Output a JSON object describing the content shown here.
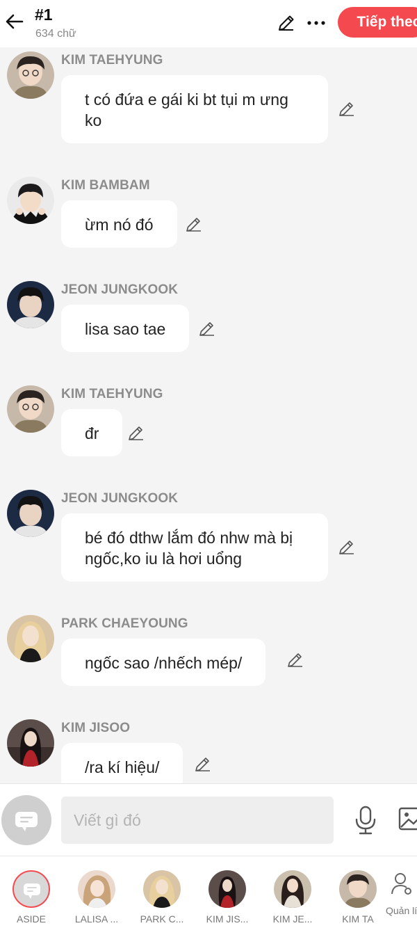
{
  "header": {
    "title": "#1",
    "word_count": "634 chữ",
    "next_label": "Tiếp theo",
    "accent_color": "#f44a4f"
  },
  "messages": [
    {
      "name": "KIM TAEHYUNG",
      "text": "t có đứa e gái ki bt tụi m ưng ko",
      "avatar": "kim-taehyung"
    },
    {
      "name": "KIM BAMBAM",
      "text": "ừm nó đó",
      "avatar": "kim-bambam"
    },
    {
      "name": "JEON JUNGKOOK",
      "text": "lisa sao tae",
      "avatar": "jeon-jungkook"
    },
    {
      "name": "KIM TAEHYUNG",
      "text": "đr",
      "avatar": "kim-taehyung"
    },
    {
      "name": "JEON JUNGKOOK",
      "text": "bé đó dthw lắm đó nhw mà bị ngốc,ko iu là hơi uổng",
      "avatar": "jeon-jungkook"
    },
    {
      "name": "PARK CHAEYOUNG",
      "text": "ngốc sao /nhếch mép/",
      "avatar": "park-chaeyoung"
    },
    {
      "name": "KIM JISOO",
      "text": "/ra kí hiệu/",
      "avatar": "kim-jisoo"
    }
  ],
  "input": {
    "placeholder": "Viết gì đó"
  },
  "characters": [
    {
      "label": "ASIDE"
    },
    {
      "label": "LALISA ..."
    },
    {
      "label": "PARK C..."
    },
    {
      "label": "KIM JIS..."
    },
    {
      "label": "KIM JE..."
    },
    {
      "label": "KIM TA"
    }
  ],
  "manage_label": "Quản lí"
}
